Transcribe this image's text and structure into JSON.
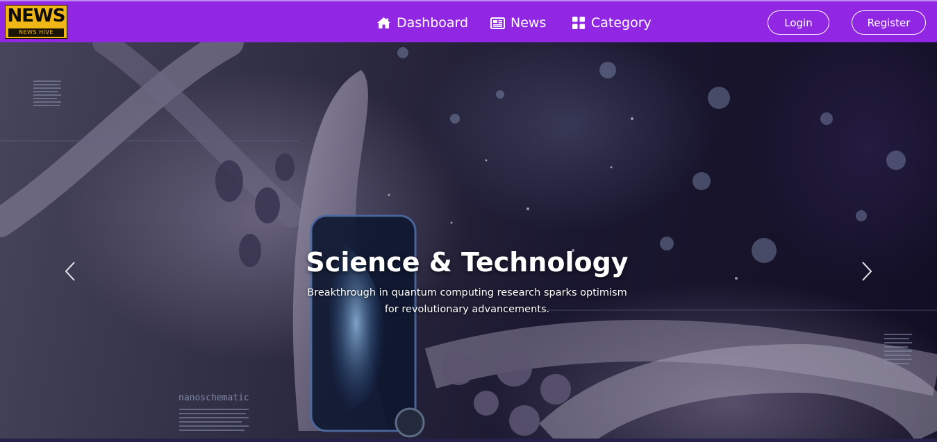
{
  "brand": {
    "title": "NEWS",
    "subtitle": "NEWS HIVE",
    "bg_color": "#f0b716"
  },
  "navbar": {
    "bg_color": "#9127e3",
    "items": [
      {
        "label": "Dashboard",
        "icon": "home-icon"
      },
      {
        "label": "News",
        "icon": "newspaper-icon"
      },
      {
        "label": "Category",
        "icon": "grid-icon"
      }
    ],
    "login_label": "Login",
    "register_label": "Register"
  },
  "hero": {
    "title": "Science & Technology",
    "caption": "Breakthrough in quantum computing research sparks optimism for revolutionary advancements.",
    "prev_icon": "chevron-left-icon",
    "next_icon": "chevron-right-icon",
    "watermark": "nanoschematic"
  }
}
